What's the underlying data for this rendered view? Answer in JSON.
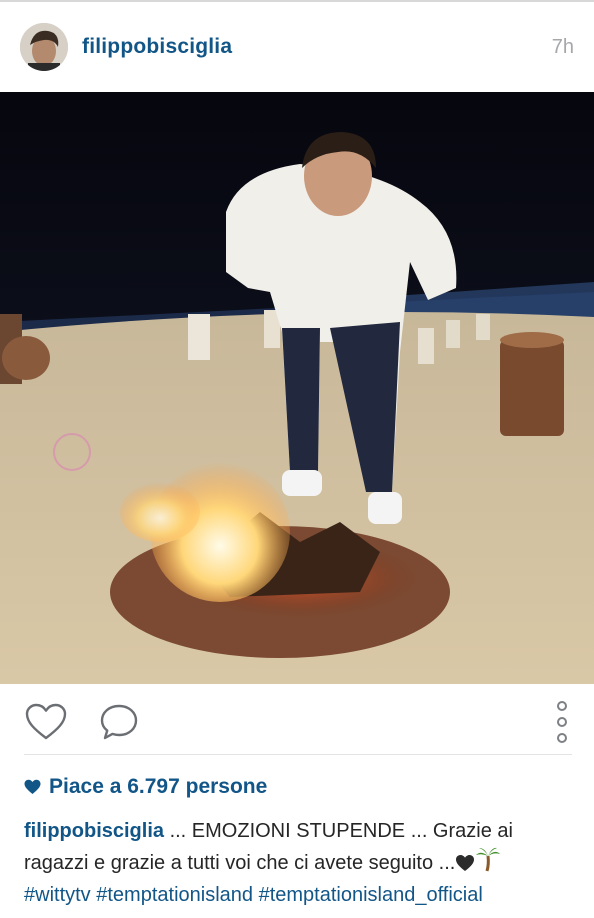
{
  "post": {
    "username": "filippobisciglia",
    "time_ago": "7h"
  },
  "photo": {
    "description_icon": "beach-bonfire-photo"
  },
  "actions": {
    "like_icon": "heart-outline-icon",
    "comment_icon": "comment-bubble-icon",
    "more_icon": "vertical-dots-icon"
  },
  "likes": {
    "text": "Piace a 6.797 persone"
  },
  "caption": {
    "username": "filippobisciglia",
    "text_line1": " ... EMOZIONI STUPENDE ... Grazie ai ragazzi e grazie a tutti voi che ci avete seguito ...",
    "hashtags": [
      "#wittytv",
      "#temptationisland",
      "#temptationisland_official"
    ]
  },
  "colors": {
    "brand_blue": "#125688",
    "muted_gray": "#a5a7aa",
    "text": "#262626"
  }
}
